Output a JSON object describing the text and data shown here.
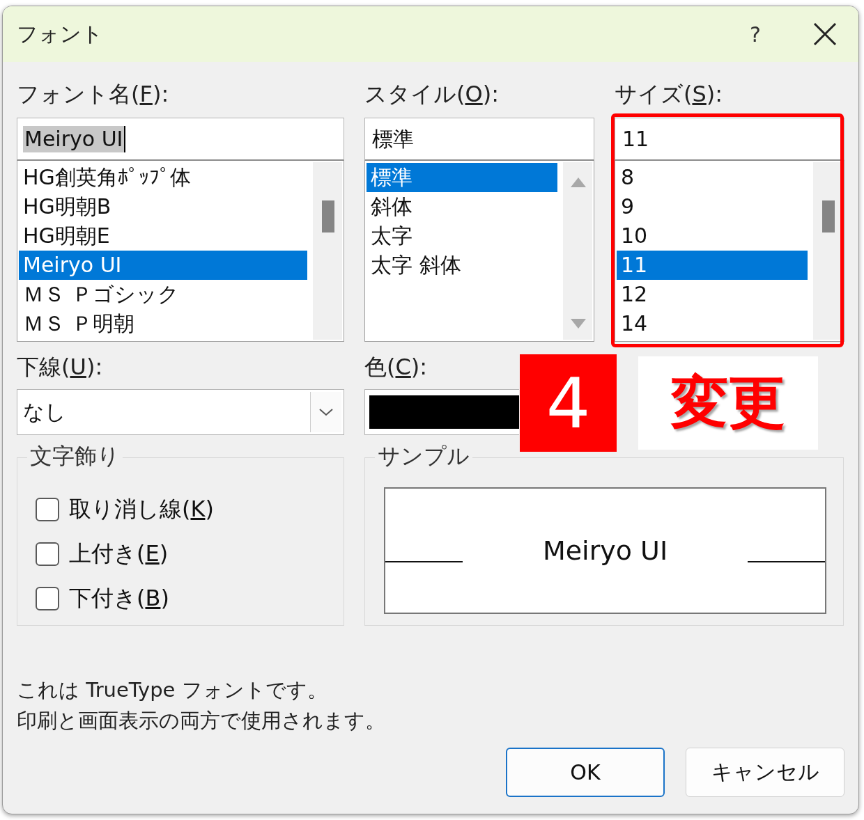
{
  "window": {
    "title": "フォント",
    "help_button": "?"
  },
  "font_name": {
    "label": {
      "before": "フォント名(",
      "key": "F",
      "after": "):"
    },
    "value": "Meiryo UI",
    "value_selected": true,
    "items": [
      {
        "label": "HG創英角ﾎﾟｯﾌﾟ体",
        "selected": false
      },
      {
        "label": "HG明朝B",
        "selected": false
      },
      {
        "label": "HG明朝E",
        "selected": false
      },
      {
        "label": "Meiryo UI",
        "selected": true
      },
      {
        "label": "ＭＳ Ｐゴシック",
        "selected": false
      },
      {
        "label": "ＭＳ Ｐ明朝",
        "selected": false
      }
    ]
  },
  "style": {
    "label": {
      "before": "スタイル(",
      "key": "O",
      "after": "):"
    },
    "value": "標準",
    "value_selected": false,
    "scroll_arrows": true,
    "items": [
      {
        "label": "標準",
        "selected": true
      },
      {
        "label": "斜体",
        "selected": false
      },
      {
        "label": "太字",
        "selected": false
      },
      {
        "label": "太字 斜体",
        "selected": false
      }
    ]
  },
  "size": {
    "label": {
      "before": "サイズ(",
      "key": "S",
      "after": "):"
    },
    "value": "11",
    "value_selected": false,
    "highlighted": true,
    "items": [
      {
        "label": "8",
        "selected": false
      },
      {
        "label": "9",
        "selected": false
      },
      {
        "label": "10",
        "selected": false
      },
      {
        "label": "11",
        "selected": true
      },
      {
        "label": "12",
        "selected": false
      },
      {
        "label": "14",
        "selected": false
      }
    ]
  },
  "underline": {
    "label": {
      "before": "下線(",
      "key": "U",
      "after": "):"
    },
    "value": "なし"
  },
  "color": {
    "label": {
      "before": "色(",
      "key": "C",
      "after": "):"
    },
    "color": "#000000"
  },
  "effects": {
    "title": "文字飾り",
    "items": [
      {
        "label": {
          "before": "取り消し線(",
          "key": "K",
          "after": ")"
        },
        "checked": false
      },
      {
        "label": {
          "before": "上付き(",
          "key": "E",
          "after": ")"
        },
        "checked": false
      },
      {
        "label": {
          "before": "下付き(",
          "key": "B",
          "after": ")"
        },
        "checked": false
      }
    ]
  },
  "sample": {
    "title": "サンプル",
    "text": "Meiryo UI"
  },
  "description": [
    "これは TrueType フォントです。",
    "印刷と画面表示の両方で使用されます。"
  ],
  "buttons": [
    {
      "label": "OK",
      "default": true
    },
    {
      "label": "キャンセル",
      "default": false
    }
  ],
  "annotations": {
    "step_badge": "4",
    "callout": "変更"
  }
}
